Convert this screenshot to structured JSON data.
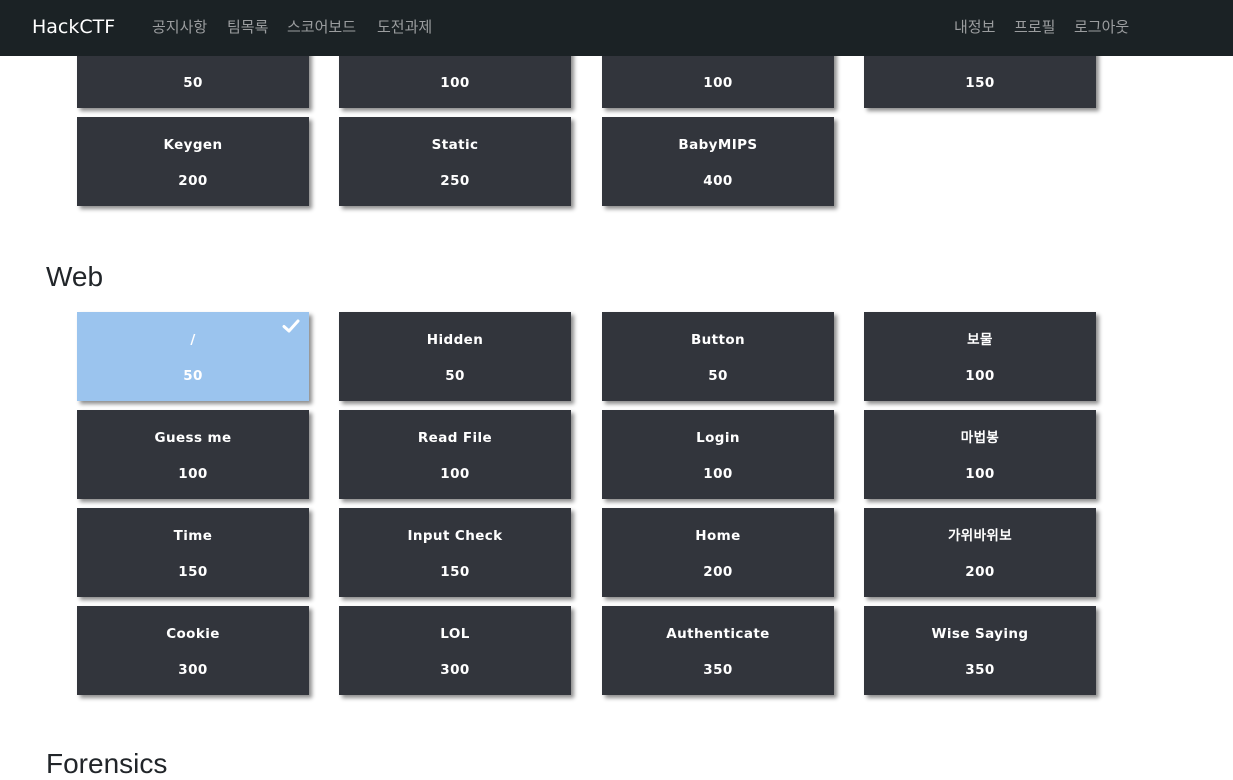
{
  "navbar": {
    "brand": "HackCTF",
    "left_links": [
      "공지사항",
      "팀목록",
      "스코어보드",
      "도전과제"
    ],
    "right_links": [
      "내정보",
      "프로필",
      "로그아웃"
    ]
  },
  "reversing_partial": {
    "rows": [
      [
        {
          "name": "",
          "points": "50"
        },
        {
          "name": "",
          "points": "100"
        },
        {
          "name": "",
          "points": "100"
        },
        {
          "name": "",
          "points": "150"
        }
      ],
      [
        {
          "name": "Keygen",
          "points": "200"
        },
        {
          "name": "Static",
          "points": "250"
        },
        {
          "name": "BabyMIPS",
          "points": "400"
        }
      ]
    ]
  },
  "web": {
    "title": "Web",
    "rows": [
      [
        {
          "name": "/",
          "points": "50",
          "solved": true
        },
        {
          "name": "Hidden",
          "points": "50"
        },
        {
          "name": "Button",
          "points": "50"
        },
        {
          "name": "보물",
          "points": "100"
        }
      ],
      [
        {
          "name": "Guess me",
          "points": "100"
        },
        {
          "name": "Read File",
          "points": "100"
        },
        {
          "name": "Login",
          "points": "100"
        },
        {
          "name": "마법봉",
          "points": "100"
        }
      ],
      [
        {
          "name": "Time",
          "points": "150"
        },
        {
          "name": "Input Check",
          "points": "150"
        },
        {
          "name": "Home",
          "points": "200"
        },
        {
          "name": "가위바위보",
          "points": "200"
        }
      ],
      [
        {
          "name": "Cookie",
          "points": "300"
        },
        {
          "name": "LOL",
          "points": "300"
        },
        {
          "name": "Authenticate",
          "points": "350"
        },
        {
          "name": "Wise Saying",
          "points": "350"
        }
      ]
    ]
  },
  "forensics": {
    "title": "Forensics"
  },
  "colors": {
    "navbar_bg": "#1b2225",
    "card_bg": "#32353c",
    "card_solved_bg": "#9bc4ee",
    "nav_link": "#9b9d9f"
  },
  "icons": {
    "solved": "check-icon"
  }
}
